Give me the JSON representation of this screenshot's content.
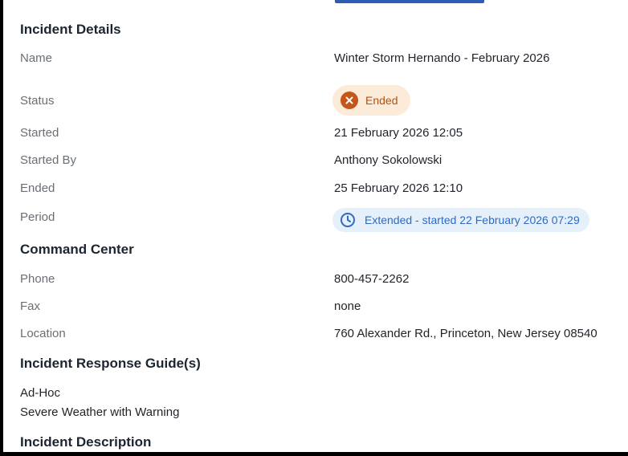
{
  "incident_details": {
    "title": "Incident Details",
    "fields": {
      "name": {
        "label": "Name",
        "value": "Winter Storm Hernando - February 2026"
      },
      "status": {
        "label": "Status",
        "value": "Ended"
      },
      "started": {
        "label": "Started",
        "value": "21 February 2026 12:05"
      },
      "started_by": {
        "label": "Started By",
        "value": "Anthony Sokolowski"
      },
      "ended": {
        "label": "Ended",
        "value": "25 February 2026 12:10"
      },
      "period": {
        "label": "Period",
        "value": "Extended - started 22 February 2026 07:29"
      }
    }
  },
  "command_center": {
    "title": "Command Center",
    "fields": {
      "phone": {
        "label": "Phone",
        "value": "800-457-2262"
      },
      "fax": {
        "label": "Fax",
        "value": "none"
      },
      "location": {
        "label": "Location",
        "value": "760 Alexander Rd., Princeton, New Jersey 08540"
      }
    }
  },
  "response_guides": {
    "title": "Incident Response Guide(s)",
    "items": [
      "Ad-Hoc",
      "Severe Weather with Warning"
    ]
  },
  "incident_description": {
    "title": "Incident Description"
  },
  "icons": {
    "status": "close-circle-icon",
    "period": "clock-icon"
  },
  "colors": {
    "status_badge_bg": "#fdebd9",
    "status_badge_text": "#b5520f",
    "status_icon": "#c4561a",
    "period_badge_bg": "#e6f0fb",
    "period_badge_text": "#2f6bc1"
  }
}
